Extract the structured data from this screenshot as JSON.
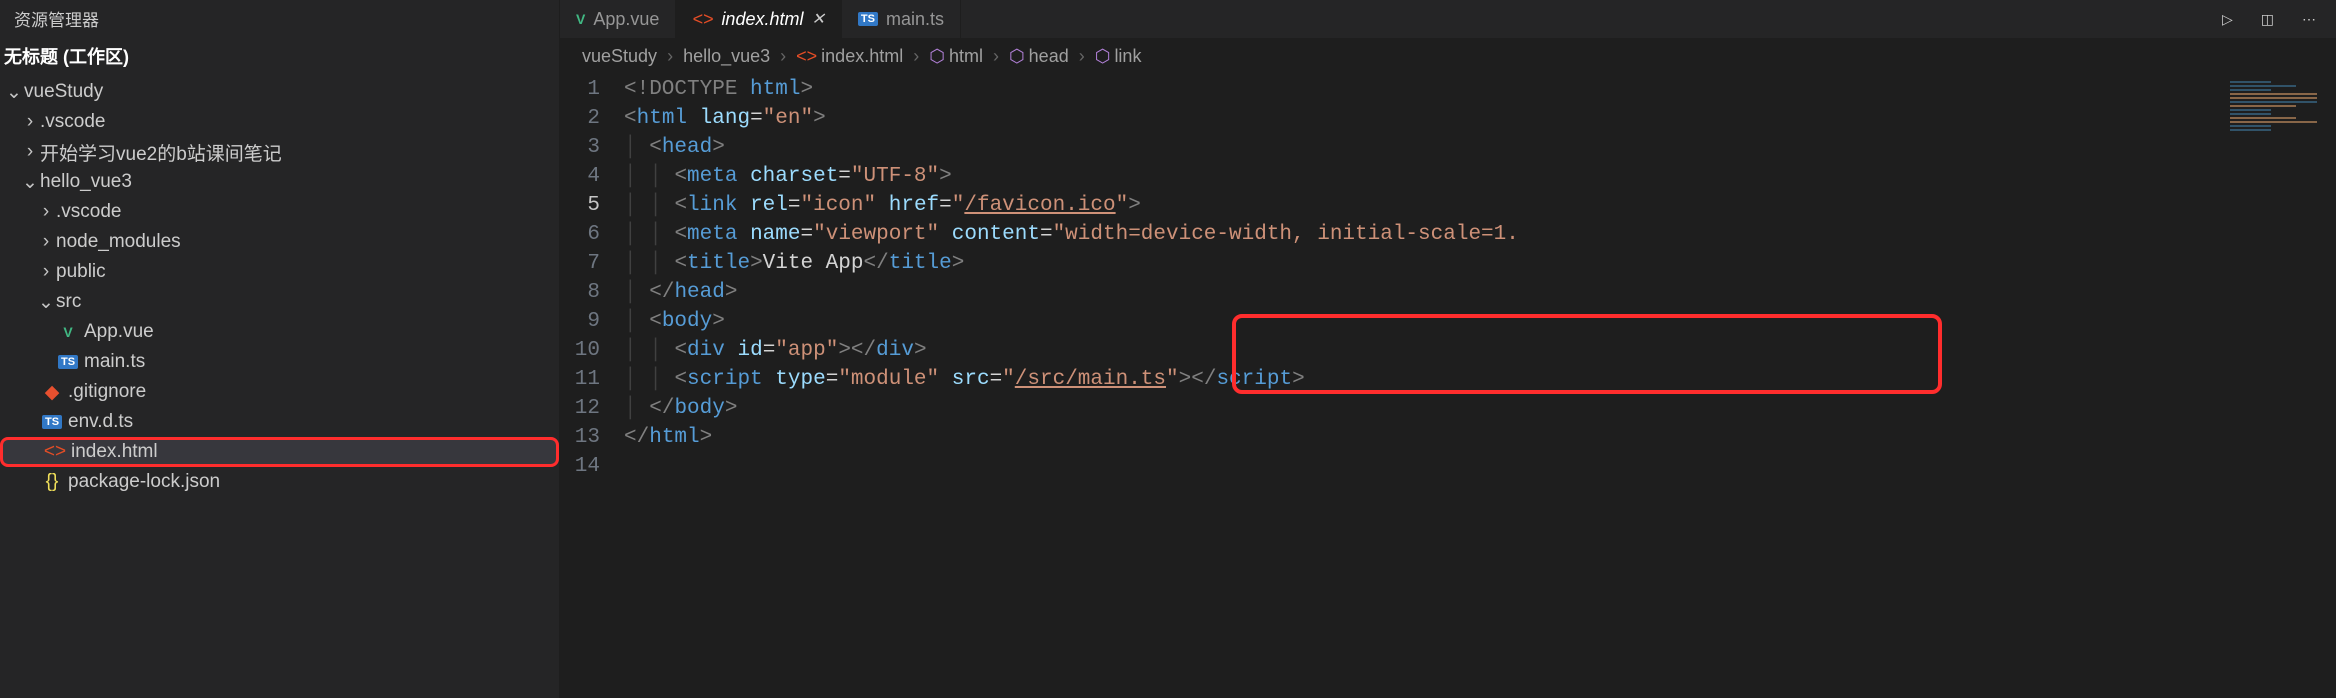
{
  "explorer": {
    "title": "资源管理器",
    "workspace": "无标题 (工作区)",
    "root": "vueStudy",
    "items_lvl1": [
      ".vscode",
      "开始学习vue2的b站课间笔记"
    ],
    "folder_open": "hello_vue3",
    "items_lvl2": [
      ".vscode",
      "node_modules",
      "public"
    ],
    "src_folder": "src",
    "src_files": [
      {
        "name": "App.vue",
        "type": "vue"
      },
      {
        "name": "main.ts",
        "type": "ts"
      }
    ],
    "root_files": [
      {
        "name": ".gitignore",
        "type": "git"
      },
      {
        "name": "env.d.ts",
        "type": "ts"
      },
      {
        "name": "index.html",
        "type": "html",
        "selected": true,
        "boxed": true
      },
      {
        "name": "package-lock.json",
        "type": "json"
      }
    ]
  },
  "tabs": {
    "items": [
      {
        "label": "App.vue",
        "type": "vue",
        "active": false
      },
      {
        "label": "index.html",
        "type": "html",
        "active": true
      },
      {
        "label": "main.ts",
        "type": "ts",
        "active": false
      }
    ]
  },
  "breadcrumbs": {
    "parts": [
      "vueStudy",
      "hello_vue3",
      "index.html",
      "html",
      "head",
      "link"
    ]
  },
  "code": {
    "lines": [
      {
        "n": 1,
        "indent": 0,
        "html": "<span class='c-gray'>&lt;!DOCTYPE <span class='c-blue'>html</span>&gt;</span>"
      },
      {
        "n": 2,
        "indent": 0,
        "html": "<span class='c-gray'>&lt;</span><span class='c-blue'>html</span> <span class='c-lightblue'>lang</span><span class='c-white'>=</span><span class='c-string'>\"en\"</span><span class='c-gray'>&gt;</span>"
      },
      {
        "n": 3,
        "indent": 1,
        "html": "<span class='c-gray'>&lt;</span><span class='c-blue'>head</span><span class='c-gray'>&gt;</span>"
      },
      {
        "n": 4,
        "indent": 2,
        "html": "<span class='c-gray'>&lt;</span><span class='c-blue'>meta</span> <span class='c-lightblue'>charset</span><span class='c-white'>=</span><span class='c-string'>\"UTF-8\"</span><span class='c-gray'>&gt;</span>"
      },
      {
        "n": 5,
        "indent": 2,
        "active": true,
        "html": "<span class='c-gray'>&lt;</span><span class='c-blue'>link</span> <span class='c-lightblue'>rel</span><span class='c-white'>=</span><span class='c-string'>\"icon\"</span> <span class='c-lightblue'>href</span><span class='c-white'>=</span><span class='c-string'>\"<span class='c-link'>/favicon.ico</span>\"</span><span class='c-gray'>&gt;</span>"
      },
      {
        "n": 6,
        "indent": 2,
        "html": "<span class='c-gray'>&lt;</span><span class='c-blue'>meta</span> <span class='c-lightblue'>name</span><span class='c-white'>=</span><span class='c-string'>\"viewport\"</span> <span class='c-lightblue'>content</span><span class='c-white'>=</span><span class='c-string'>\"width=device-width, initial-scale=1.</span>"
      },
      {
        "n": 7,
        "indent": 2,
        "html": "<span class='c-gray'>&lt;</span><span class='c-blue'>title</span><span class='c-gray'>&gt;</span><span class='c-white'>Vite App</span><span class='c-gray'>&lt;/</span><span class='c-blue'>title</span><span class='c-gray'>&gt;</span>"
      },
      {
        "n": 8,
        "indent": 1,
        "html": "<span class='c-gray'>&lt;/</span><span class='c-blue'>head</span><span class='c-gray'>&gt;</span>"
      },
      {
        "n": 9,
        "indent": 1,
        "html": "<span class='c-gray'>&lt;</span><span class='c-blue'>body</span><span class='c-gray'>&gt;</span>"
      },
      {
        "n": 10,
        "indent": 2,
        "html": "<span class='c-gray'>&lt;</span><span class='c-blue'>div</span> <span class='c-lightblue'>id</span><span class='c-white'>=</span><span class='c-string'>\"app\"</span><span class='c-gray'>&gt;&lt;/</span><span class='c-blue'>div</span><span class='c-gray'>&gt;</span>"
      },
      {
        "n": 11,
        "indent": 2,
        "html": "<span class='c-gray'>&lt;</span><span class='c-blue'>script</span> <span class='c-lightblue'>type</span><span class='c-white'>=</span><span class='c-string'>\"module\"</span> <span class='c-lightblue'>src</span><span class='c-white'>=</span><span class='c-string'>\"<span class='c-link'>/src/main.ts</span>\"</span><span class='c-gray'>&gt;&lt;/</span><span class='c-blue'>script</span><span class='c-gray'>&gt;</span>"
      },
      {
        "n": 12,
        "indent": 1,
        "html": "<span class='c-gray'>&lt;/</span><span class='c-blue'>body</span><span class='c-gray'>&gt;</span>"
      },
      {
        "n": 13,
        "indent": 0,
        "html": "<span class='c-gray'>&lt;/</span><span class='c-blue'>html</span><span class='c-gray'>&gt;</span>"
      },
      {
        "n": 14,
        "indent": 0,
        "html": ""
      }
    ]
  }
}
